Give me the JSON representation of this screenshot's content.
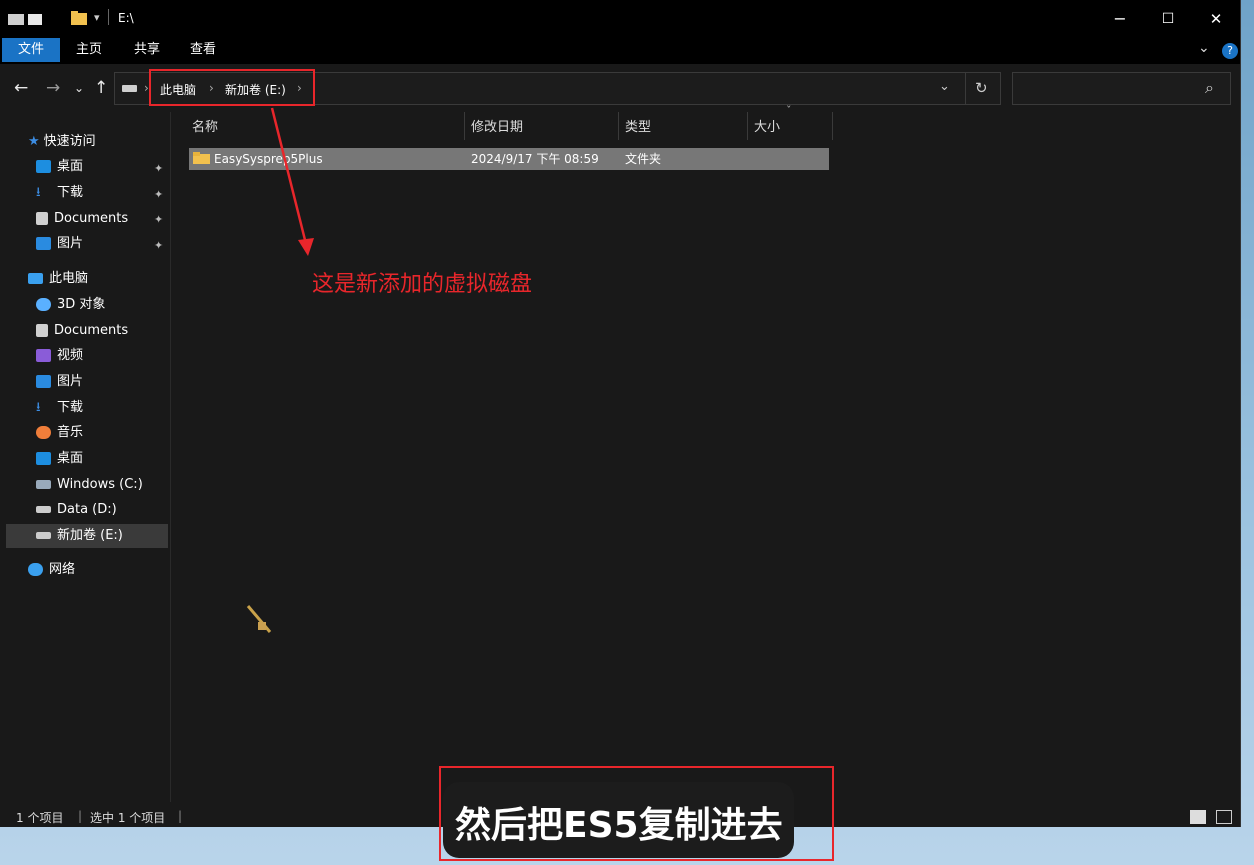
{
  "window": {
    "title": "E:\\",
    "qa_glyph": "▾",
    "controls": {
      "minimize": "−",
      "maximize": "☐",
      "close": "✕"
    }
  },
  "ribbon": {
    "tabs": [
      "文件",
      "主页",
      "共享",
      "查看"
    ],
    "expand_glyph": "⌄",
    "help_glyph": "?"
  },
  "address": {
    "back": "←",
    "forward": "→",
    "recent": "⌄",
    "up": "↑",
    "sep": "›",
    "crumbs": [
      "此电脑",
      "新加卷 (E:)"
    ],
    "dropdown": "⌄",
    "refresh": "↻",
    "search_icon": "⌕"
  },
  "nav": {
    "quick_access": "快速访问",
    "quick_items": [
      "桌面",
      "下载",
      "Documents",
      "图片"
    ],
    "this_pc": "此电脑",
    "pc_items": [
      "3D 对象",
      "Documents",
      "视频",
      "图片",
      "下载",
      "音乐",
      "桌面",
      "Windows (C:)",
      "Data (D:)",
      "新加卷 (E:)"
    ],
    "network": "网络",
    "pin_glyph": "📌"
  },
  "columns": {
    "name": "名称",
    "date": "修改日期",
    "type": "类型",
    "size": "大小"
  },
  "files": [
    {
      "name": "EasySysprep5Plus",
      "date": "2024/9/17 下午 08:59",
      "type": "文件夹",
      "size": ""
    }
  ],
  "status": {
    "count": "1 个项目",
    "selected": "选中 1 个项目",
    "sep": "|"
  },
  "annotation": {
    "callout": "这是新添加的虚拟磁盘",
    "subtitle": "然后把ES5复制进去"
  },
  "colors": {
    "accent": "#1a73c5",
    "annotation_red": "#e8262b",
    "folder": "#f2c14e"
  }
}
